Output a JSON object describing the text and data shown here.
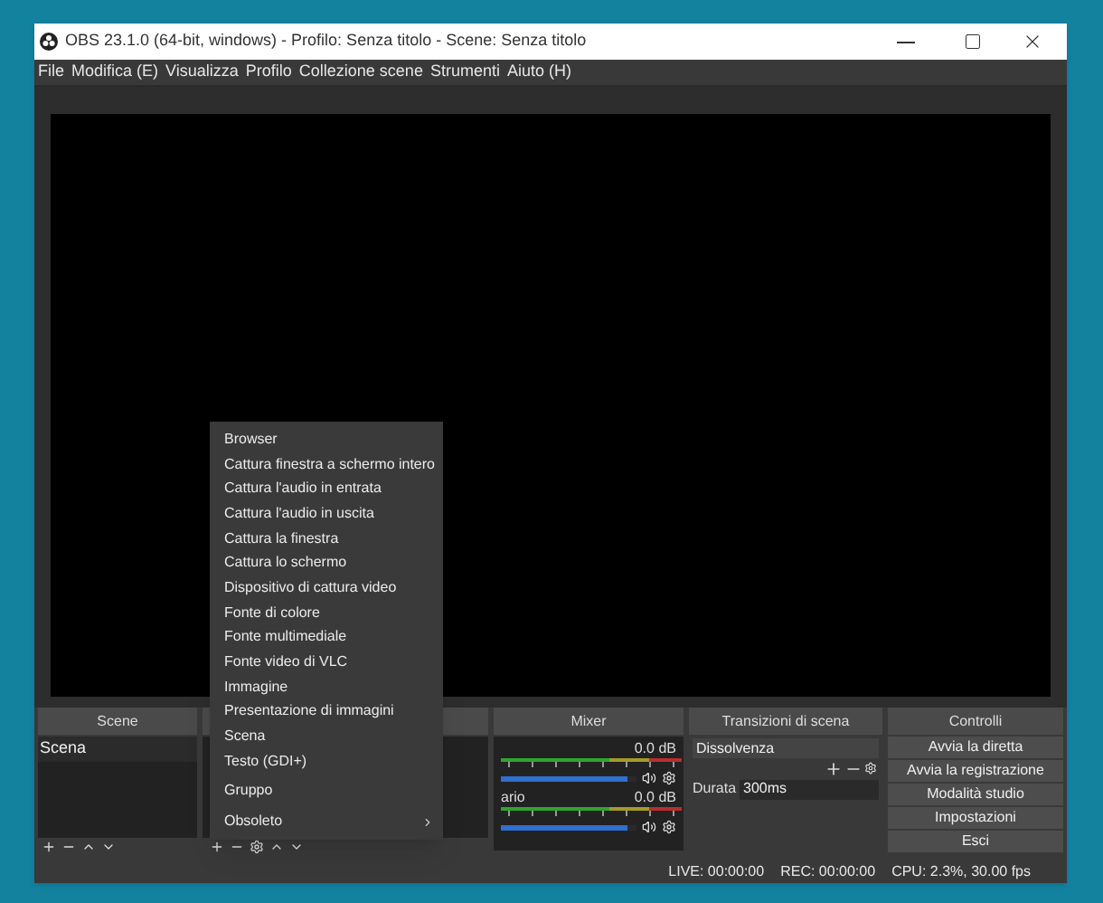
{
  "window": {
    "title": "OBS 23.1.0 (64-bit, windows) - Profilo: Senza titolo - Scene: Senza titolo"
  },
  "menu_bar": [
    "File",
    "Modifica (E)",
    "Visualizza",
    "Profilo",
    "Collezione scene",
    "Strumenti",
    "Aiuto (H)"
  ],
  "scenes_dock": {
    "title": "Scene",
    "items": [
      {
        "label": "Scena",
        "selected": false
      }
    ]
  },
  "mixer_dock": {
    "title": "Mixer",
    "channels": [
      {
        "reading": "0.0 dB",
        "level": 0.93,
        "muted": false
      },
      {
        "name": "ario",
        "reading": "0.0 dB",
        "level": 0.93,
        "muted": false
      }
    ]
  },
  "transitions_dock": {
    "title": "Transizioni di scena",
    "transition": "Dissolvenza",
    "duration_label": "Durata",
    "duration": "300ms"
  },
  "controls_dock": {
    "title": "Controlli",
    "buttons": [
      "Avvia la diretta",
      "Avvia la registrazione",
      "Modalità studio",
      "Impostazioni",
      "Esci"
    ]
  },
  "add_source_menu": {
    "items": [
      {
        "label": "Browser",
        "kind": "item"
      },
      {
        "label": "Cattura finestra a schermo intero",
        "kind": "item"
      },
      {
        "label": "Cattura l'audio in entrata",
        "kind": "item"
      },
      {
        "label": "Cattura l'audio in uscita",
        "kind": "item"
      },
      {
        "label": "Cattura la finestra",
        "kind": "item"
      },
      {
        "label": "Cattura lo schermo",
        "kind": "item"
      },
      {
        "label": "Dispositivo di cattura video",
        "kind": "item"
      },
      {
        "label": "Fonte di colore",
        "kind": "item"
      },
      {
        "label": "Fonte multimediale",
        "kind": "item"
      },
      {
        "label": "Fonte video di VLC",
        "kind": "item"
      },
      {
        "label": "Immagine",
        "kind": "item"
      },
      {
        "label": "Presentazione di immagini",
        "kind": "item"
      },
      {
        "label": "Scena",
        "kind": "item"
      },
      {
        "label": "Testo (GDI+)",
        "kind": "item"
      },
      {
        "label": "Gruppo",
        "kind": "separated"
      },
      {
        "label": "Obsoleto",
        "kind": "submenu"
      }
    ]
  },
  "status_bar": [
    "LIVE: 00:00:00",
    "REC: 00:00:00",
    "CPU: 2.3%, 30.00 fps"
  ]
}
